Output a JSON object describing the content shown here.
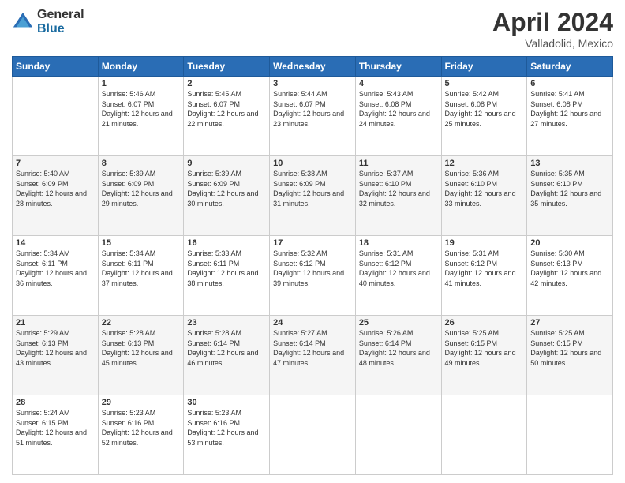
{
  "logo": {
    "general": "General",
    "blue": "Blue"
  },
  "header": {
    "title": "April 2024",
    "subtitle": "Valladolid, Mexico"
  },
  "weekdays": [
    "Sunday",
    "Monday",
    "Tuesday",
    "Wednesday",
    "Thursday",
    "Friday",
    "Saturday"
  ],
  "weeks": [
    [
      {
        "day": "",
        "sunrise": "",
        "sunset": "",
        "daylight": ""
      },
      {
        "day": "1",
        "sunrise": "Sunrise: 5:46 AM",
        "sunset": "Sunset: 6:07 PM",
        "daylight": "Daylight: 12 hours and 21 minutes."
      },
      {
        "day": "2",
        "sunrise": "Sunrise: 5:45 AM",
        "sunset": "Sunset: 6:07 PM",
        "daylight": "Daylight: 12 hours and 22 minutes."
      },
      {
        "day": "3",
        "sunrise": "Sunrise: 5:44 AM",
        "sunset": "Sunset: 6:07 PM",
        "daylight": "Daylight: 12 hours and 23 minutes."
      },
      {
        "day": "4",
        "sunrise": "Sunrise: 5:43 AM",
        "sunset": "Sunset: 6:08 PM",
        "daylight": "Daylight: 12 hours and 24 minutes."
      },
      {
        "day": "5",
        "sunrise": "Sunrise: 5:42 AM",
        "sunset": "Sunset: 6:08 PM",
        "daylight": "Daylight: 12 hours and 25 minutes."
      },
      {
        "day": "6",
        "sunrise": "Sunrise: 5:41 AM",
        "sunset": "Sunset: 6:08 PM",
        "daylight": "Daylight: 12 hours and 27 minutes."
      }
    ],
    [
      {
        "day": "7",
        "sunrise": "Sunrise: 5:40 AM",
        "sunset": "Sunset: 6:09 PM",
        "daylight": "Daylight: 12 hours and 28 minutes."
      },
      {
        "day": "8",
        "sunrise": "Sunrise: 5:39 AM",
        "sunset": "Sunset: 6:09 PM",
        "daylight": "Daylight: 12 hours and 29 minutes."
      },
      {
        "day": "9",
        "sunrise": "Sunrise: 5:39 AM",
        "sunset": "Sunset: 6:09 PM",
        "daylight": "Daylight: 12 hours and 30 minutes."
      },
      {
        "day": "10",
        "sunrise": "Sunrise: 5:38 AM",
        "sunset": "Sunset: 6:09 PM",
        "daylight": "Daylight: 12 hours and 31 minutes."
      },
      {
        "day": "11",
        "sunrise": "Sunrise: 5:37 AM",
        "sunset": "Sunset: 6:10 PM",
        "daylight": "Daylight: 12 hours and 32 minutes."
      },
      {
        "day": "12",
        "sunrise": "Sunrise: 5:36 AM",
        "sunset": "Sunset: 6:10 PM",
        "daylight": "Daylight: 12 hours and 33 minutes."
      },
      {
        "day": "13",
        "sunrise": "Sunrise: 5:35 AM",
        "sunset": "Sunset: 6:10 PM",
        "daylight": "Daylight: 12 hours and 35 minutes."
      }
    ],
    [
      {
        "day": "14",
        "sunrise": "Sunrise: 5:34 AM",
        "sunset": "Sunset: 6:11 PM",
        "daylight": "Daylight: 12 hours and 36 minutes."
      },
      {
        "day": "15",
        "sunrise": "Sunrise: 5:34 AM",
        "sunset": "Sunset: 6:11 PM",
        "daylight": "Daylight: 12 hours and 37 minutes."
      },
      {
        "day": "16",
        "sunrise": "Sunrise: 5:33 AM",
        "sunset": "Sunset: 6:11 PM",
        "daylight": "Daylight: 12 hours and 38 minutes."
      },
      {
        "day": "17",
        "sunrise": "Sunrise: 5:32 AM",
        "sunset": "Sunset: 6:12 PM",
        "daylight": "Daylight: 12 hours and 39 minutes."
      },
      {
        "day": "18",
        "sunrise": "Sunrise: 5:31 AM",
        "sunset": "Sunset: 6:12 PM",
        "daylight": "Daylight: 12 hours and 40 minutes."
      },
      {
        "day": "19",
        "sunrise": "Sunrise: 5:31 AM",
        "sunset": "Sunset: 6:12 PM",
        "daylight": "Daylight: 12 hours and 41 minutes."
      },
      {
        "day": "20",
        "sunrise": "Sunrise: 5:30 AM",
        "sunset": "Sunset: 6:13 PM",
        "daylight": "Daylight: 12 hours and 42 minutes."
      }
    ],
    [
      {
        "day": "21",
        "sunrise": "Sunrise: 5:29 AM",
        "sunset": "Sunset: 6:13 PM",
        "daylight": "Daylight: 12 hours and 43 minutes."
      },
      {
        "day": "22",
        "sunrise": "Sunrise: 5:28 AM",
        "sunset": "Sunset: 6:13 PM",
        "daylight": "Daylight: 12 hours and 45 minutes."
      },
      {
        "day": "23",
        "sunrise": "Sunrise: 5:28 AM",
        "sunset": "Sunset: 6:14 PM",
        "daylight": "Daylight: 12 hours and 46 minutes."
      },
      {
        "day": "24",
        "sunrise": "Sunrise: 5:27 AM",
        "sunset": "Sunset: 6:14 PM",
        "daylight": "Daylight: 12 hours and 47 minutes."
      },
      {
        "day": "25",
        "sunrise": "Sunrise: 5:26 AM",
        "sunset": "Sunset: 6:14 PM",
        "daylight": "Daylight: 12 hours and 48 minutes."
      },
      {
        "day": "26",
        "sunrise": "Sunrise: 5:25 AM",
        "sunset": "Sunset: 6:15 PM",
        "daylight": "Daylight: 12 hours and 49 minutes."
      },
      {
        "day": "27",
        "sunrise": "Sunrise: 5:25 AM",
        "sunset": "Sunset: 6:15 PM",
        "daylight": "Daylight: 12 hours and 50 minutes."
      }
    ],
    [
      {
        "day": "28",
        "sunrise": "Sunrise: 5:24 AM",
        "sunset": "Sunset: 6:15 PM",
        "daylight": "Daylight: 12 hours and 51 minutes."
      },
      {
        "day": "29",
        "sunrise": "Sunrise: 5:23 AM",
        "sunset": "Sunset: 6:16 PM",
        "daylight": "Daylight: 12 hours and 52 minutes."
      },
      {
        "day": "30",
        "sunrise": "Sunrise: 5:23 AM",
        "sunset": "Sunset: 6:16 PM",
        "daylight": "Daylight: 12 hours and 53 minutes."
      },
      {
        "day": "",
        "sunrise": "",
        "sunset": "",
        "daylight": ""
      },
      {
        "day": "",
        "sunrise": "",
        "sunset": "",
        "daylight": ""
      },
      {
        "day": "",
        "sunrise": "",
        "sunset": "",
        "daylight": ""
      },
      {
        "day": "",
        "sunrise": "",
        "sunset": "",
        "daylight": ""
      }
    ]
  ]
}
